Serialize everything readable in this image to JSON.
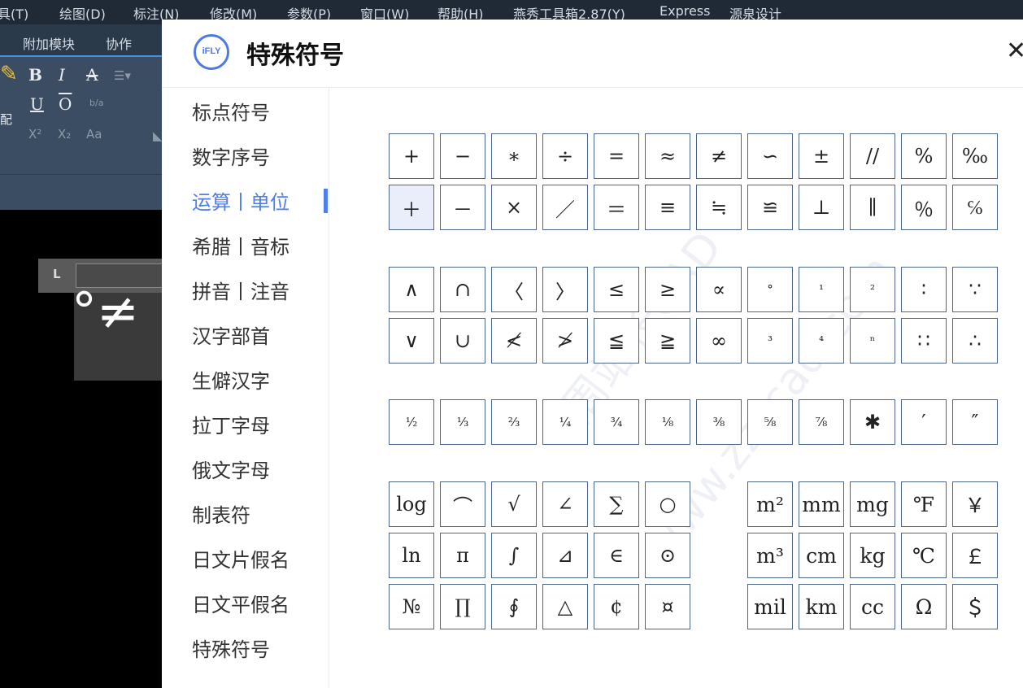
{
  "app": {
    "menu": [
      "具(T)",
      "绘图(D)",
      "标注(N)",
      "修改(M)",
      "参数(P)",
      "窗口(W)",
      "帮助(H)",
      "燕秀工具箱2.87(Y)",
      "Express",
      "源泉设计"
    ],
    "ribbon_tabs": [
      "附加模块",
      "协作"
    ],
    "ribbon_tools": {
      "bold": "B",
      "italic": "I",
      "strike": "A",
      "underline": "U",
      "overline": "O",
      "stack": "b/a",
      "superscript": "X²",
      "subscript": "X₂",
      "case": "Aa",
      "match_label": "配"
    },
    "ruler_mark": "L",
    "preview_text": "°≠"
  },
  "dialog": {
    "title": "特殊符号",
    "logo_text": "iFLY",
    "close_glyph": "✕",
    "watermark": "周站长CAD",
    "watermark2": "www.zzzcad.com",
    "nav": [
      {
        "label": "标点符号",
        "active": false
      },
      {
        "label": "数字序号",
        "active": false
      },
      {
        "label": "运算丨单位",
        "active": true
      },
      {
        "label": "希腊丨音标",
        "active": false
      },
      {
        "label": "拼音丨注音",
        "active": false
      },
      {
        "label": "汉字部首",
        "active": false
      },
      {
        "label": "生僻汉字",
        "active": false
      },
      {
        "label": "拉丁字母",
        "active": false
      },
      {
        "label": "俄文字母",
        "active": false
      },
      {
        "label": "制表符",
        "active": false
      },
      {
        "label": "日文片假名",
        "active": false
      },
      {
        "label": "日文平假名",
        "active": false
      },
      {
        "label": "特殊符号",
        "active": false
      }
    ],
    "selected_symbol": "＋",
    "symbol_rows": [
      [
        "+",
        "−",
        "∗",
        "÷",
        "=",
        "≈",
        "≠",
        "∽",
        "±",
        "//",
        "%",
        "‰"
      ],
      [
        "＋",
        "－",
        "×",
        "／",
        "＝",
        "≡",
        "≒",
        "≌",
        "⊥",
        "∥",
        "％",
        "℅"
      ],
      [
        "∧",
        "∩",
        "〈",
        "〉",
        "≤",
        "≥",
        "∝",
        "°",
        "¹",
        "²",
        "∶",
        "∵"
      ],
      [
        "∨",
        "∪",
        "≮",
        "≯",
        "≦",
        "≧",
        "∞",
        "³",
        "⁴",
        "ⁿ",
        "∷",
        "∴"
      ],
      [
        "½",
        "⅓",
        "⅔",
        "¼",
        "¾",
        "⅛",
        "⅜",
        "⅝",
        "⅞",
        "✱",
        "′",
        "″"
      ],
      [
        "log",
        "⌒",
        "√",
        "∠",
        "∑",
        "○"
      ],
      [
        "ln",
        "π",
        "∫",
        "⊿",
        "∈",
        "⊙"
      ],
      [
        "№",
        "∏",
        "∮",
        "△",
        "¢",
        "¤"
      ]
    ],
    "unit_rows": [
      [
        "m²",
        "mm",
        "mg",
        "℉",
        "￥"
      ],
      [
        "m³",
        "cm",
        "kg",
        "℃",
        "￡"
      ],
      [
        "mil",
        "km",
        "cc",
        "Ω",
        "＄"
      ]
    ]
  }
}
